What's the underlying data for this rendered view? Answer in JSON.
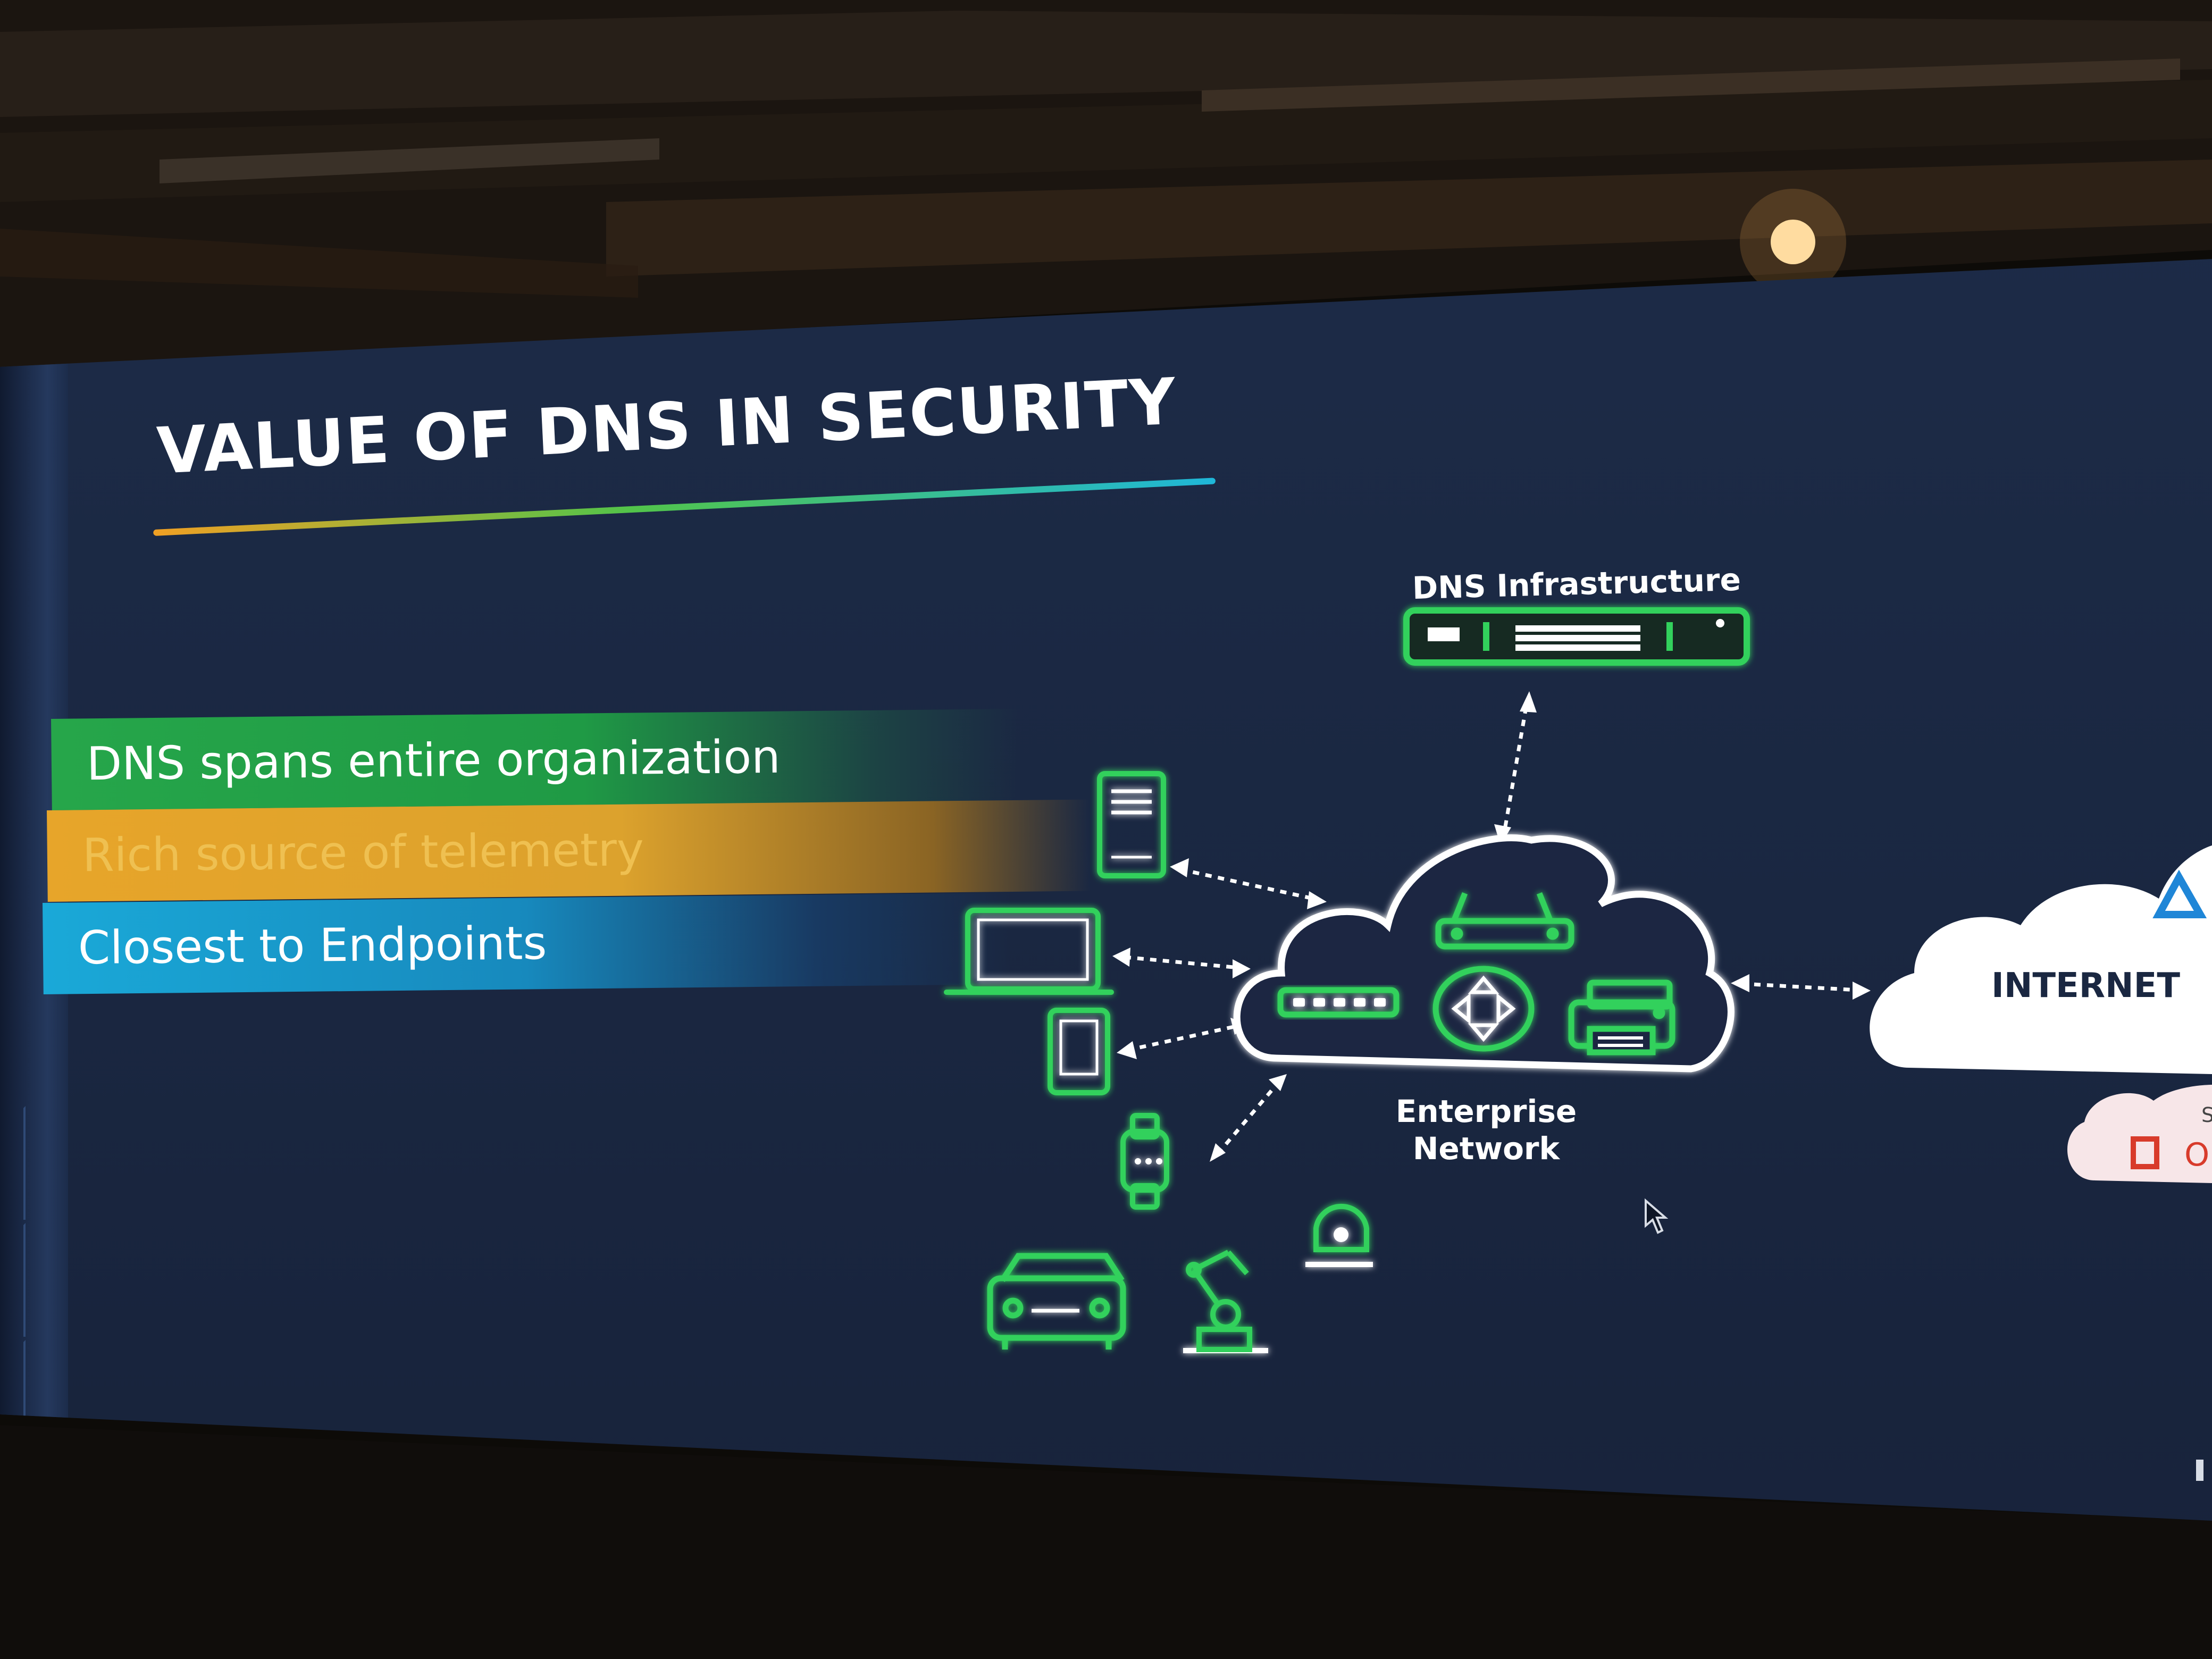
{
  "slide": {
    "title": "VALUE OF DNS IN SECURITY",
    "bars": [
      "DNS spans entire organization",
      "Rich source of telemetry",
      "Closest to Endpoints"
    ],
    "diagram": {
      "dns_label": "DNS Infrastructure",
      "network_label_line1": "Enterprise",
      "network_label_line2": "Network",
      "internet_label": "INTERNET",
      "internet_sublabel_partial": "S",
      "app_label_partial": "O"
    }
  },
  "colors": {
    "screen_bg": "#1b2943",
    "accent_green": "#33d15b",
    "bar_green": "#26a64a",
    "bar_gold": "#e7a52a",
    "bar_cyan": "#1aa9d8",
    "internet_cloud": "#ffffff",
    "saas_cloud": "#f7e6e8",
    "office_red": "#d83b2b"
  },
  "icons": [
    "server-rack-icon",
    "router-icon",
    "switch-icon",
    "routing-hub-icon",
    "printer-icon",
    "desktop-tower-icon",
    "laptop-icon",
    "tablet-icon",
    "smartwatch-icon",
    "car-icon",
    "robot-arm-icon",
    "security-camera-icon",
    "cloud-icon",
    "office-logo-icon"
  ]
}
